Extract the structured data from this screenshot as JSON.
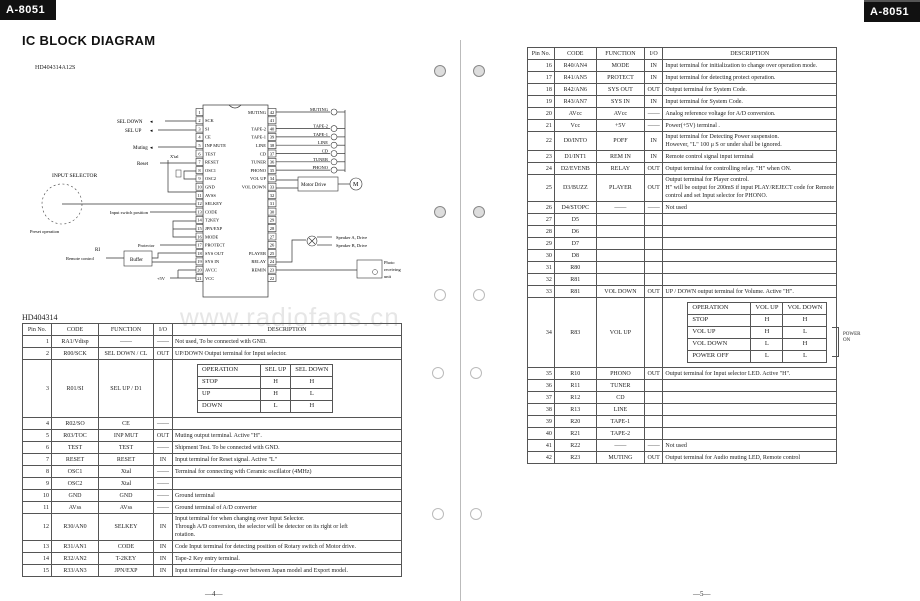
{
  "header": {
    "tag_left": "A-8051",
    "tag_right": "A-8051",
    "title": "IC BLOCK DIAGRAM",
    "chip_label": "HD404314A12S",
    "watermark": "www.radiofans.cn"
  },
  "diagram": {
    "left_pins": [
      {
        "n": "1",
        "name": ""
      },
      {
        "n": "2",
        "name": "SCK"
      },
      {
        "n": "3",
        "name": "SI"
      },
      {
        "n": "4",
        "name": "CE"
      },
      {
        "n": "5",
        "name": "INP MUTE"
      },
      {
        "n": "6",
        "name": "TEST"
      },
      {
        "n": "7",
        "name": "RESET"
      },
      {
        "n": "8",
        "name": "OSC1"
      },
      {
        "n": "9",
        "name": "OSC2"
      },
      {
        "n": "10",
        "name": "GND"
      },
      {
        "n": "11",
        "name": "AVSS"
      },
      {
        "n": "12",
        "name": "SELKEY"
      },
      {
        "n": "13",
        "name": "CODE"
      },
      {
        "n": "14",
        "name": "T2KEY"
      },
      {
        "n": "15",
        "name": "JPN/EXP"
      },
      {
        "n": "16",
        "name": "MODE"
      },
      {
        "n": "17",
        "name": "PROTECT"
      },
      {
        "n": "18",
        "name": "SYS OUT"
      },
      {
        "n": "19",
        "name": "SYS IN"
      },
      {
        "n": "20",
        "name": "AVCC"
      },
      {
        "n": "21",
        "name": "VCC"
      }
    ],
    "right_pins": [
      {
        "n": "42",
        "name": "MUTING"
      },
      {
        "n": "41",
        "name": ""
      },
      {
        "n": "40",
        "name": "TAPE-2"
      },
      {
        "n": "39",
        "name": "TAPE-1"
      },
      {
        "n": "38",
        "name": "LINE"
      },
      {
        "n": "37",
        "name": "CD"
      },
      {
        "n": "36",
        "name": "TUNER"
      },
      {
        "n": "35",
        "name": "PHONO"
      },
      {
        "n": "34",
        "name": "VOL UP"
      },
      {
        "n": "33",
        "name": "VOL DOWN"
      },
      {
        "n": "32",
        "name": ""
      },
      {
        "n": "31",
        "name": ""
      },
      {
        "n": "30",
        "name": ""
      },
      {
        "n": "29",
        "name": ""
      },
      {
        "n": "28",
        "name": ""
      },
      {
        "n": "27",
        "name": ""
      },
      {
        "n": "26",
        "name": ""
      },
      {
        "n": "25",
        "name": "PLAYER"
      },
      {
        "n": "24",
        "name": "RELAY"
      },
      {
        "n": "23",
        "name": "REMIN"
      },
      {
        "n": "22",
        "name": ""
      }
    ],
    "labels": {
      "sel_down": "SEL DOWN",
      "sel_up": "SEL UP",
      "muting_out": "Muting",
      "reset": "Reset",
      "xtal": "X'tal",
      "input_selector": "INPUT SELECTOR",
      "preset_operation": "Preset operation",
      "input_switch_position": "Input switch position",
      "protector": "Protector",
      "ri": "RI",
      "remote_control": "Remote control",
      "buffer": "Buffer",
      "plus5v": "+5V",
      "led_muting": "MUTING",
      "led_tape2": "TAPE-2",
      "led_tape1": "TAPE-1",
      "led_line": "LINE",
      "led_cd": "CD",
      "led_tuner": "TUNER",
      "led_phono": "PHONO",
      "motor_drive": "Motor Drive",
      "motor": "M",
      "speaker_a": "Speaker A, Drive",
      "speaker_b": "Speaker B, Drive",
      "photo_unit": [
        "Photo",
        "receiving",
        "unit"
      ]
    }
  },
  "left_section": {
    "label": "HD404314",
    "headers": [
      "Pin No.",
      "CODE",
      "FUNCTION",
      "I/O",
      "DESCRIPTION"
    ],
    "rows": [
      {
        "pin": "1",
        "code": "RA1/Vdisp",
        "fn": "——",
        "io": "——",
        "desc": [
          "Not used,   To be connected with GND."
        ]
      },
      {
        "pin": "2",
        "code": "R00/SCK",
        "fn": "SEL DOWN / CL",
        "io": "OUT",
        "desc": [
          "UP/DOWN Output terminal for Input selector."
        ]
      },
      {
        "pin": "3",
        "code": "R01/SI",
        "fn": "SEL UP / D1",
        "io": "",
        "desc": []
      },
      {
        "pin": "4",
        "code": "R02/SO",
        "fn": "CE",
        "io": "——",
        "desc": []
      },
      {
        "pin": "5",
        "code": "R03/TOC",
        "fn": "INP MUT",
        "io": "OUT",
        "desc": [
          "Muting output terminal.   Active \"H\"."
        ]
      },
      {
        "pin": "6",
        "code": "TEST",
        "fn": "TEST",
        "io": "——",
        "desc": [
          "Shipment Test.  To be connected with GND."
        ]
      },
      {
        "pin": "7",
        "code": "RESET",
        "fn": "RESET",
        "io": "IN",
        "desc": [
          "Input terminal for Reset signal.    Active \"L\""
        ]
      },
      {
        "pin": "8",
        "code": "OSC1",
        "fn": "Xtal",
        "io": "——",
        "desc": [
          "Terminal for connecting with Ceramic oscillator (4MHz)"
        ]
      },
      {
        "pin": "9",
        "code": "OSC2",
        "fn": "Xtal",
        "io": "——",
        "desc": []
      },
      {
        "pin": "10",
        "code": "GND",
        "fn": "GND",
        "io": "——",
        "desc": [
          "Ground terminal"
        ]
      },
      {
        "pin": "11",
        "code": "AVss",
        "fn": "AVss",
        "io": "——",
        "desc": [
          "Ground terminal of A/D converter"
        ]
      },
      {
        "pin": "12",
        "code": "R30/AN0",
        "fn": "SELKEY",
        "io": "IN",
        "desc": [
          "Input terminal for when changing over Input Selector.",
          "Through A/D conversion, the selector will be detector on its right or left",
          "rotation."
        ]
      },
      {
        "pin": "13",
        "code": "R31/AN1",
        "fn": "CODE",
        "io": "IN",
        "desc": [
          "Code Input terminal for detecting position of Rotary switch of Motor drive."
        ]
      },
      {
        "pin": "14",
        "code": "R32/AN2",
        "fn": "T-2KEY",
        "io": "IN",
        "desc": [
          "Tape-2 Key entry terminal."
        ]
      },
      {
        "pin": "15",
        "code": "R33/AN3",
        "fn": "JPN/EXP",
        "io": "IN",
        "desc": [
          "Input terminal for change-over between Japan model and Export model."
        ]
      }
    ],
    "op_table": {
      "headers": [
        "OPERATION",
        "SEL UP",
        "SEL DOWN"
      ],
      "rows": [
        [
          "STOP",
          "H",
          "H"
        ],
        [
          "UP",
          "H",
          "L"
        ],
        [
          "DOWN",
          "L",
          "H"
        ]
      ]
    },
    "page_number": "—4—"
  },
  "right_section": {
    "headers": [
      "Pin No.",
      "CODE",
      "FUNCTION",
      "I/O",
      "DESCRIPTION"
    ],
    "rows": [
      {
        "pin": "16",
        "code": "R40/AN4",
        "fn": "MODE",
        "io": "IN",
        "desc": [
          "Input terminal for initialization to change over operation mode."
        ]
      },
      {
        "pin": "17",
        "code": "R41/AN5",
        "fn": "PROTECT",
        "io": "IN",
        "desc": [
          "Input terminal for detecting protect operation."
        ]
      },
      {
        "pin": "18",
        "code": "R42/AN6",
        "fn": "SYS OUT",
        "io": "OUT",
        "desc": [
          "Output terminal for System Code."
        ]
      },
      {
        "pin": "19",
        "code": "R43/AN7",
        "fn": "SYS IN",
        "io": "IN",
        "desc": [
          "Input terminal for System Code."
        ]
      },
      {
        "pin": "20",
        "code": "AVcc",
        "fn": "AVcc",
        "io": "——",
        "desc": [
          "Analog reference voltage for A/D conversion."
        ]
      },
      {
        "pin": "21",
        "code": "Vcc",
        "fn": "+5V",
        "io": "——",
        "desc": [
          "Power(+5V) terminal ."
        ]
      },
      {
        "pin": "22",
        "code": "D0/INTO",
        "fn": "POFF",
        "io": "IN",
        "desc": [
          "Input terminal for Detecting Power suspension.",
          "However, \"L\" 100 μ S or under shall be ignored."
        ]
      },
      {
        "pin": "23",
        "code": "D1/INT1",
        "fn": "REM IN",
        "io": "IN",
        "desc": [
          "Remote control signal input terminal"
        ]
      },
      {
        "pin": "24",
        "code": "D2/EVENB",
        "fn": "RELAY",
        "io": "OUT",
        "desc": [
          "Output terminal for controlling relay.   \"H\" when ON."
        ]
      },
      {
        "pin": "25",
        "code": "D3/BUZZ",
        "fn": "PLAYER",
        "io": "OUT",
        "desc": [
          "Output terminal for Player control.",
          "H\" will be output for 200mS if input PLAY/REJECT code for Remote",
          "control and set Input selector for PHONO."
        ]
      },
      {
        "pin": "26",
        "code": "D4/STOPC",
        "fn": "——",
        "io": "——",
        "desc": [
          "Not used"
        ]
      },
      {
        "pin": "27",
        "code": "D5",
        "fn": "",
        "io": "",
        "desc": []
      },
      {
        "pin": "28",
        "code": "D6",
        "fn": "",
        "io": "",
        "desc": []
      },
      {
        "pin": "29",
        "code": "D7",
        "fn": "",
        "io": "",
        "desc": []
      },
      {
        "pin": "30",
        "code": "D8",
        "fn": "",
        "io": "",
        "desc": []
      },
      {
        "pin": "31",
        "code": "R80",
        "fn": "",
        "io": "",
        "desc": []
      },
      {
        "pin": "32",
        "code": "R81",
        "fn": "",
        "io": "",
        "desc": []
      },
      {
        "pin": "33",
        "code": "R81",
        "fn": "VOL DOWN",
        "io": "OUT",
        "desc": [
          "UP / DOWN output terminal for Volume.   Active \"H\"."
        ]
      },
      {
        "pin": "34",
        "code": "R83",
        "fn": "VOL UP",
        "io": "",
        "desc": []
      },
      {
        "pin": "35",
        "code": "R10",
        "fn": "PHONO",
        "io": "OUT",
        "desc": [
          "Output terminal for Input selector LED.   Active \"H\"."
        ]
      },
      {
        "pin": "36",
        "code": "R11",
        "fn": "TUNER",
        "io": "",
        "desc": []
      },
      {
        "pin": "37",
        "code": "R12",
        "fn": "CD",
        "io": "",
        "desc": []
      },
      {
        "pin": "38",
        "code": "R13",
        "fn": "LINE",
        "io": "",
        "desc": []
      },
      {
        "pin": "39",
        "code": "R20",
        "fn": "TAPE-1",
        "io": "",
        "desc": []
      },
      {
        "pin": "40",
        "code": "R21",
        "fn": "TAPE-2",
        "io": "",
        "desc": []
      },
      {
        "pin": "41",
        "code": "R22",
        "fn": "——",
        "io": "——",
        "desc": [
          "Not used"
        ]
      },
      {
        "pin": "42",
        "code": "R23",
        "fn": "MUTING",
        "io": "OUT",
        "desc": [
          "Output terminal for Audio muting LED, Remote control"
        ]
      }
    ],
    "op_table": {
      "headers": [
        "OPERATION",
        "VOL UP",
        "VOL DOWN"
      ],
      "rows": [
        [
          "STOP",
          "H",
          "H"
        ],
        [
          "VOL UP",
          "H",
          "L"
        ],
        [
          "VOL DOWN",
          "L",
          "H"
        ],
        [
          "POWER OFF",
          "L",
          "L"
        ]
      ]
    },
    "power_on_label": [
      "POWER",
      "ON"
    ],
    "page_number": "—5—"
  }
}
